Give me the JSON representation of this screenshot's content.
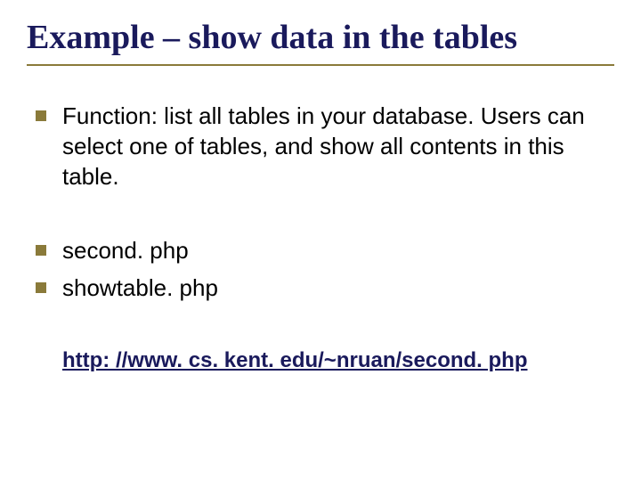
{
  "title": "Example – show data in the tables",
  "bullets": {
    "group1": [
      "Function: list all tables in your database. Users can select one of tables, and show all contents in this table."
    ],
    "group2": [
      "second. php",
      "showtable. php"
    ]
  },
  "link": "http: //www. cs. kent. edu/~nruan/second. php"
}
